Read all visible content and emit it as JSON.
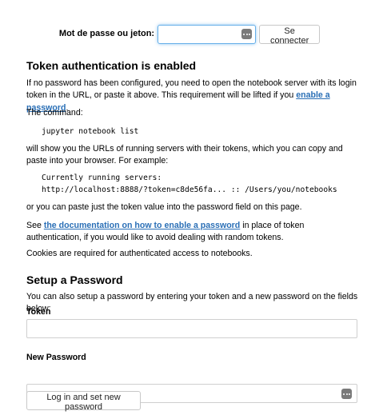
{
  "login": {
    "label": "Mot de passe ou jeton:",
    "password_value": "",
    "connect_label": "Se connecter"
  },
  "token_section": {
    "heading": "Token authentication is enabled",
    "intro_text": "If no password has been configured, you need to open the notebook server with its login token in the URL, or paste it above. This requirement will be lifted if you",
    "enable_password_link": "enable a password",
    "intro_end": ".",
    "command_label": "The command:",
    "command": "jupyter notebook list",
    "urls_text": "will show you the URLs of running servers with their tokens, which you can copy and paste into your browser. For example:",
    "example_line1": "Currently running servers:",
    "example_line2": "http://localhost:8888/?token=c8de56fa... :: /Users/you/notebooks",
    "paste_text": "or you can paste just the token value into the password field on this page.",
    "see_text": "See",
    "docs_link": "the documentation on how to enable a password",
    "see_end": "in place of token authentication, if you would like to avoid dealing with random tokens.",
    "cookies_text": "Cookies are required for authenticated access to notebooks."
  },
  "setup_section": {
    "heading": "Setup a Password",
    "intro_text": "You can also setup a password by entering your token and a new password on the fields below:",
    "token_label": "Token",
    "new_password_label": "New Password",
    "submit_label": "Log in and set new password"
  },
  "icons": {
    "password_manager": "password-key-icon"
  }
}
